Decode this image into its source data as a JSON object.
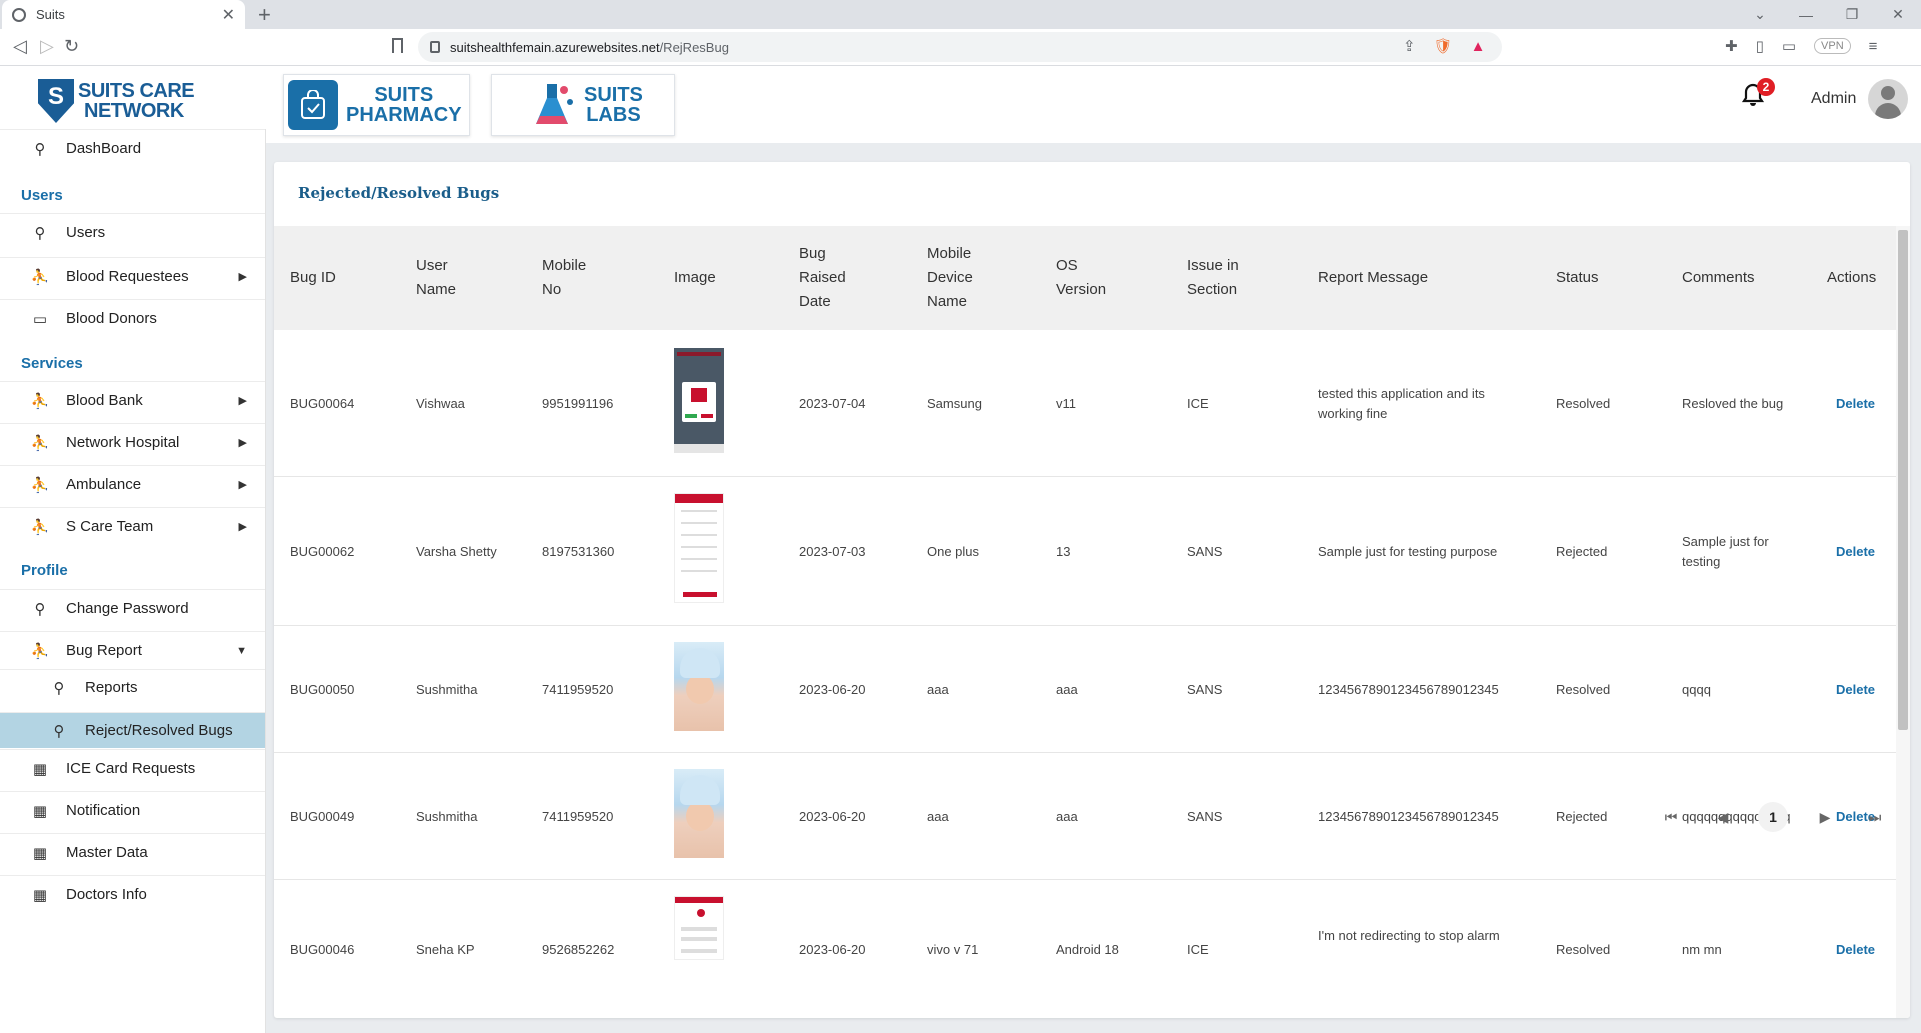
{
  "browser": {
    "tab_title": "Suits",
    "url_host": "suitshealthfemain.azurewebsites.net",
    "url_path": "/RejResBug",
    "vpn_label": "VPN"
  },
  "header": {
    "logo_text_line1": "SUITS CARE",
    "logo_text_line2": "NETWORK",
    "pharmacy_line1": "SUITS",
    "pharmacy_line2": "PHARMACY",
    "labs_line1": "SUITS",
    "labs_line2": "LABS",
    "notification_count": "2",
    "user_name": "Admin"
  },
  "sidebar": {
    "dashboard": "DashBoard",
    "section_users": "Users",
    "users": "Users",
    "blood_requestees": "Blood Requestees",
    "blood_donors": "Blood Donors",
    "section_services": "Services",
    "blood_bank": "Blood Bank",
    "network_hospital": "Network Hospital",
    "ambulance": "Ambulance",
    "s_care_team": "S Care Team",
    "section_profile": "Profile",
    "change_password": "Change Password",
    "bug_report": "Bug Report",
    "reports": "Reports",
    "reject_resolved": "Reject/Resolved Bugs",
    "ice_card": "ICE Card Requests",
    "notification": "Notification",
    "master_data": "Master Data",
    "doctors_info": "Doctors Info"
  },
  "page": {
    "title": "Rejected/Resolved Bugs"
  },
  "table": {
    "headers": {
      "bug_id": "Bug ID",
      "user_name_1": "User",
      "user_name_2": "Name",
      "mobile_1": "Mobile",
      "mobile_2": "No",
      "image": "Image",
      "date_1": "Bug",
      "date_2": "Raised",
      "date_3": "Date",
      "device_1": "Mobile",
      "device_2": "Device",
      "device_3": "Name",
      "os_1": "OS",
      "os_2": "Version",
      "section_1": "Issue in",
      "section_2": "Section",
      "message": "Report Message",
      "status": "Status",
      "comments": "Comments",
      "actions": "Actions"
    },
    "rows": [
      {
        "id": "BUG00064",
        "user": "Vishwaa",
        "mobile": "9951991196",
        "image": "screenshot-red-dialog",
        "date": "2023-07-04",
        "device": "Samsung",
        "os": "v11",
        "section": "ICE",
        "msg1": "tested this application and its",
        "msg2": "working fine",
        "status": "Resolved",
        "com1": "Resloved the bug",
        "com2": "",
        "action": "Delete"
      },
      {
        "id": "BUG00062",
        "user": "Varsha Shetty",
        "mobile": "8197531360",
        "image": "screenshot-form",
        "date": "2023-07-03",
        "device": "One plus",
        "os": "13",
        "section": "SANS",
        "msg1": "Sample just for testing purpose",
        "msg2": "",
        "status": "Rejected",
        "com1": "Sample just for",
        "com2": "testing",
        "action": "Delete"
      },
      {
        "id": "BUG00050",
        "user": "Sushmitha",
        "mobile": "7411959520",
        "image": "baby-photo",
        "date": "2023-06-20",
        "device": "aaa",
        "os": "aaa",
        "section": "SANS",
        "msg1": "1234567890123456789012345",
        "msg2": "",
        "status": "Resolved",
        "com1": "qqqq",
        "com2": "",
        "action": "Delete"
      },
      {
        "id": "BUG00049",
        "user": "Sushmitha",
        "mobile": "7411959520",
        "image": "baby-photo",
        "date": "2023-06-20",
        "device": "aaa",
        "os": "aaa",
        "section": "SANS",
        "msg1": "1234567890123456789012345",
        "msg2": "",
        "status": "Rejected",
        "com1": "qqqqqqqqqqqqqqq",
        "com2": "",
        "action": "Delete"
      },
      {
        "id": "BUG00046",
        "user": "Sneha KP",
        "mobile": "9526852262",
        "image": "screenshot-list",
        "date": "2023-06-20",
        "device": "vivo v 71",
        "os": "Android 18",
        "section": "ICE",
        "msg1": "I'm not redirecting to stop alarm",
        "msg2": "",
        "status": "Resolved",
        "com1": "nm mn",
        "com2": "",
        "action": "Delete"
      }
    ]
  },
  "pagination": {
    "current_page": "1"
  },
  "colors": {
    "accent": "#1a6fa8",
    "active_bg": "#b3d4e3",
    "badge": "#e01e25"
  }
}
